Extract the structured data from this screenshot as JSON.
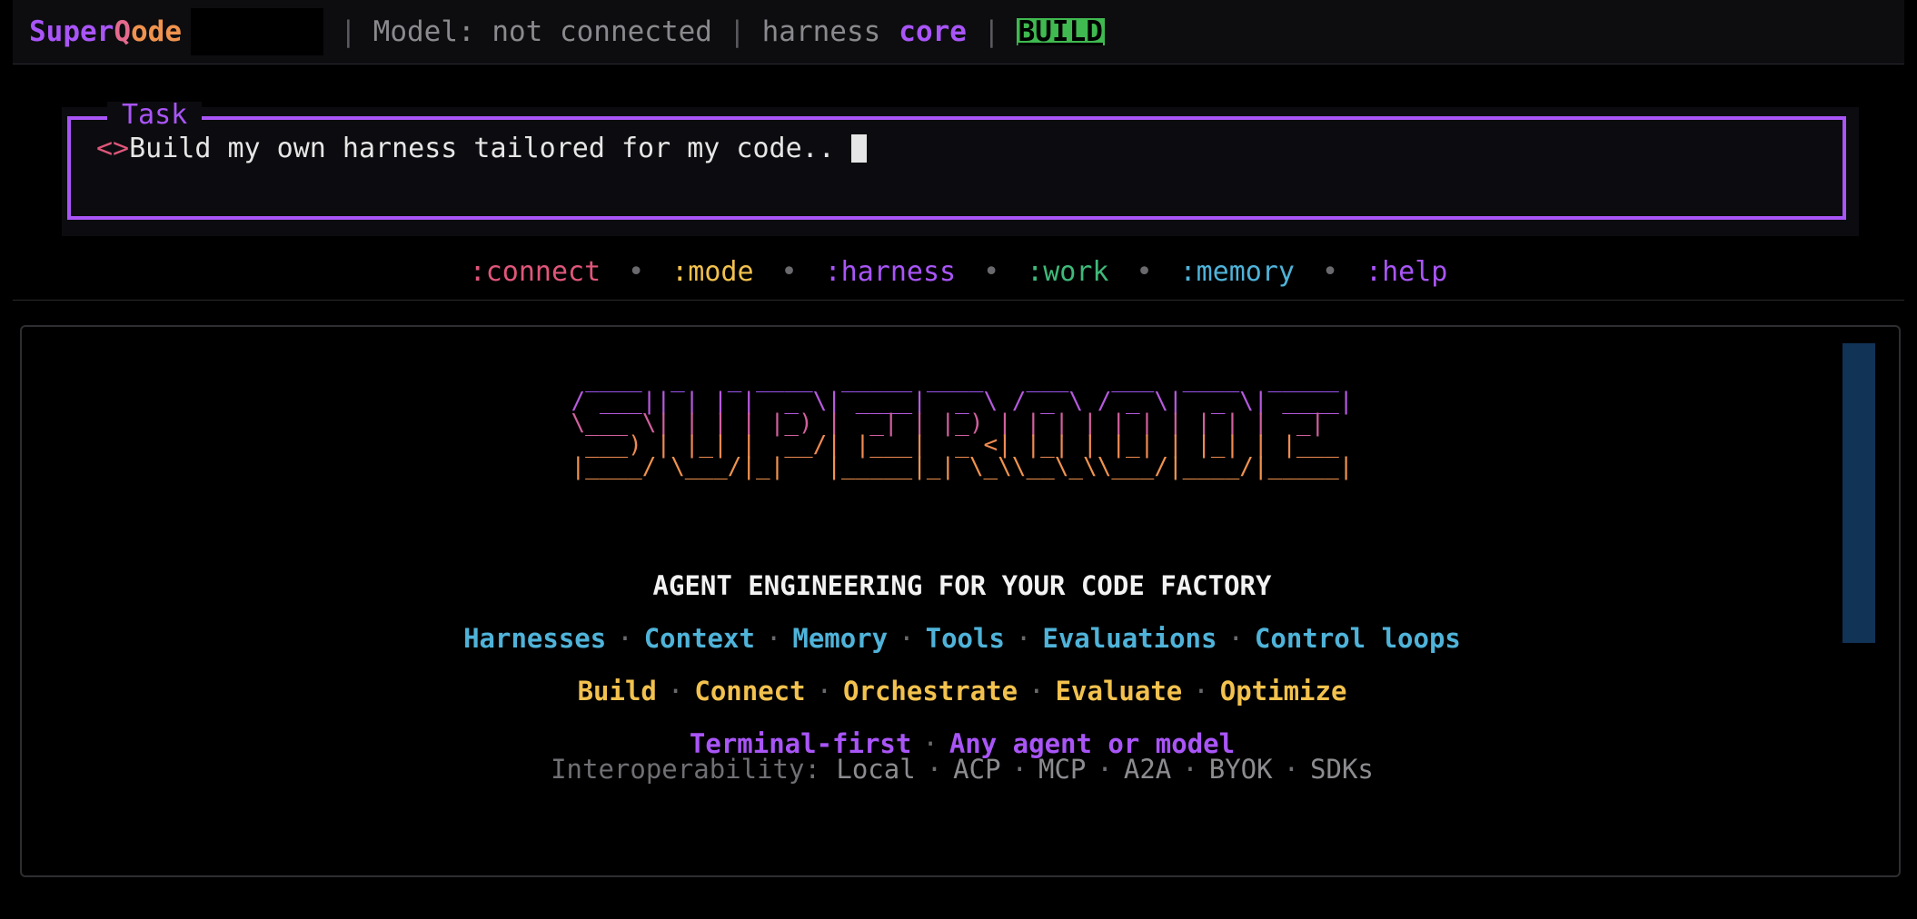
{
  "topbar": {
    "brand_part1": "Super",
    "brand_part2": "Q",
    "brand_part3": "ode",
    "separator": "|",
    "model_status": "Model: not connected",
    "harness_label": "harness",
    "harness_value": "core",
    "mode_badge": "BUILD"
  },
  "task": {
    "legend": "Task",
    "prompt_mark": "<>",
    "value": "Build my own harness tailored for my code.."
  },
  "hints": {
    "dot": "•",
    "items": [
      ":connect",
      ":mode",
      ":harness",
      ":work",
      ":memory",
      ":help"
    ]
  },
  "logo": {
    "lines": [
      " ____  _   _ ____  _____ ____   ___   ___  ____  _____ ",
      "/ ___|| | | |  _ \\| ____|  _ \\ / _ \\ / _ \\|  _ \\| ____|",
      "\\___ \\| | | | |_) |  _| | |_) | | | | | | | | | |  _|  ",
      " ___) | |_| |  __/| |___|  _ <| |_| | |_| | |_| | |___ ",
      "|____/ \\___/|_|   |_____|_| \\_\\\\__\\_\\\\___/|____/|_____|"
    ]
  },
  "hero": {
    "tagline": "AGENT ENGINEERING FOR YOUR CODE FACTORY",
    "sep": "·",
    "features": [
      "Harnesses",
      "Context",
      "Memory",
      "Tools",
      "Evaluations",
      "Control loops"
    ],
    "actions": [
      "Build",
      "Connect",
      "Orchestrate",
      "Evaluate",
      "Optimize"
    ],
    "principles": [
      "Terminal-first",
      "Any agent or model"
    ],
    "interop_label": "Interoperability:",
    "interop": [
      "Local",
      "ACP",
      "MCP",
      "A2A",
      "BYOK",
      "SDKs"
    ]
  },
  "colors": {
    "accent_purple": "#a955f7",
    "pink": "#e0567a",
    "orange": "#f0934e",
    "yellow": "#f2c14e",
    "green": "#3fb97a",
    "blue": "#4fb3d9",
    "badge_green": "#3fb950",
    "scrollbar": "#113356"
  },
  "icons": {
    "cursor": "block-cursor"
  }
}
